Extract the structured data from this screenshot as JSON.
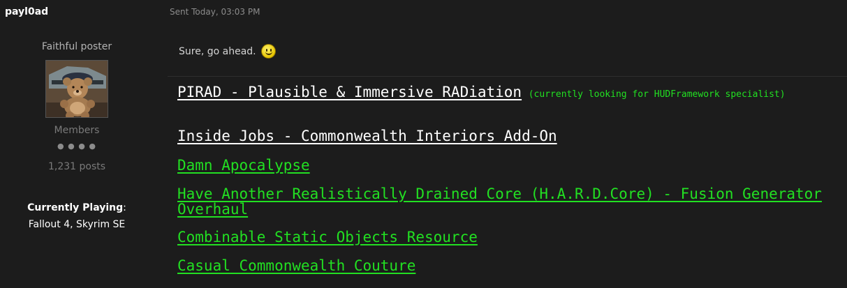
{
  "author": {
    "name": "payl0ad",
    "title": "Faithful poster",
    "group": "Members",
    "pips": "● ● ● ●",
    "posts": "1,231 posts",
    "playing_label": "Currently Playing",
    "playing_colon": ":",
    "playing_value": "Fallout 4, Skyrim SE"
  },
  "post": {
    "sent": "Sent Today, 03:03 PM",
    "message": "Sure, go ahead."
  },
  "signature": {
    "items": [
      {
        "label": "PIRAD - Plausible & Immersive RADiation",
        "note": "(currently looking for HUDFramework specialist)",
        "color": "#ffffff"
      },
      {
        "label": "Inside Jobs - Commonwealth Interiors Add-On",
        "color": "#ffffff"
      },
      {
        "label": "Damn Apocalypse",
        "color": "#22e022"
      },
      {
        "label": "Have Another Realistically Drained Core (H.A.R.D.Core) - Fusion Generator Overhaul",
        "color": "#22e022"
      },
      {
        "label": "Combinable Static Objects Resource",
        "color": "#22e022"
      },
      {
        "label": "Casual Commonwealth Couture",
        "color": "#22e022"
      }
    ]
  },
  "icons": {
    "emoji": "smiley-icon",
    "avatar": "teddy-bear-avatar"
  }
}
